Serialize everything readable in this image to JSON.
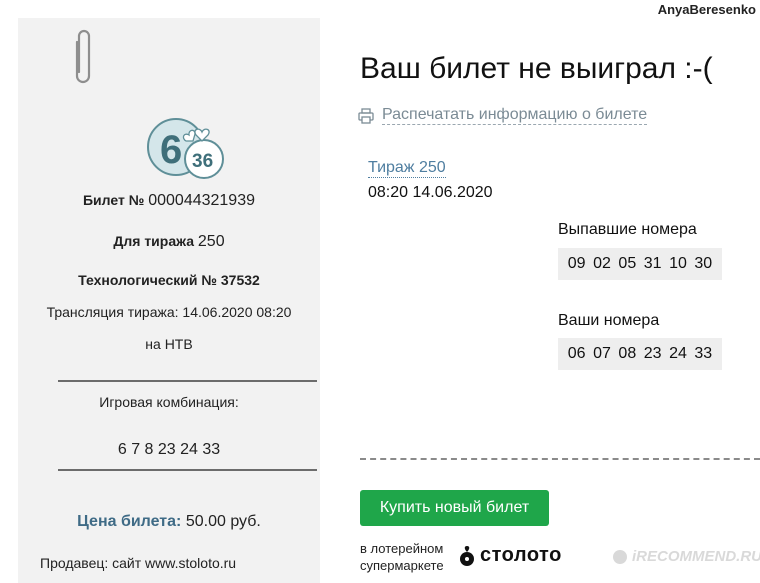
{
  "author": "AnyaBeresenko",
  "ticket": {
    "logo": {
      "main": "6",
      "sub": "36"
    },
    "ticket_no_label": "Билет №",
    "ticket_no": "000044321939",
    "draw_label": "Для тиража",
    "draw_no": "250",
    "tech_no": "Технологический № 37532",
    "broadcast_line1": "Трансляция тиража: 14.06.2020 08:20",
    "broadcast_line2": "на НТВ",
    "combo_label": "Игровая комбинация:",
    "combo_value": "6 7 8 23 24 33",
    "price_label": "Цена билета:",
    "price_value": "50.00 руб.",
    "seller": "Продавец: сайт www.stoloto.ru"
  },
  "result": {
    "headline": "Ваш билет не выиграл :-(",
    "print_link": "Распечатать информацию о билете",
    "draw_link": "Тираж 250",
    "draw_datetime": "08:20 14.06.2020",
    "drawn_label": "Выпавшие номера",
    "drawn_numbers": [
      "09",
      "02",
      "05",
      "31",
      "10",
      "30"
    ],
    "your_label": "Ваши номера",
    "your_numbers": [
      "06",
      "07",
      "08",
      "23",
      "24",
      "33"
    ],
    "buy_button": "Купить новый билет",
    "sold_at_line1": "в лотерейном",
    "sold_at_line2": "супермаркете",
    "brand": "столото"
  },
  "watermark": "iRECOMMEND.RU",
  "colors": {
    "button": "#1fa64a",
    "link": "#4f7ea0",
    "ticket_bg": "#f2f2f2",
    "price_label": "#3f6b86"
  },
  "icons": [
    "paperclip-icon",
    "printer-icon",
    "stoloto-logo-icon"
  ]
}
